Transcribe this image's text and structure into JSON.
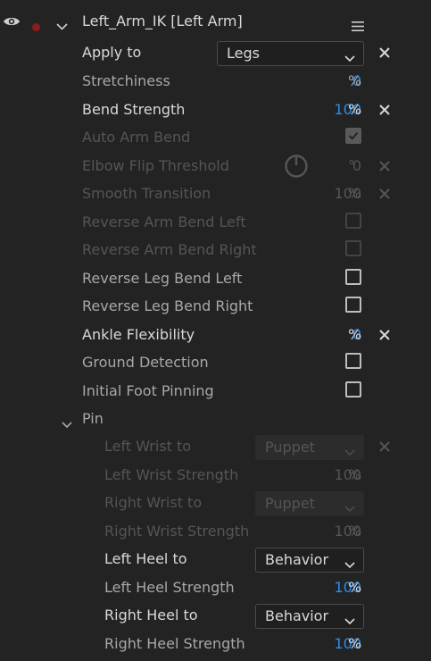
{
  "header": {
    "title": "Left_Arm_IK [Left Arm]"
  },
  "colors": {
    "background": "#232323",
    "value_blue": "#2d8ceb",
    "record_dot": "#8a1d1d"
  },
  "rows": {
    "apply_to": {
      "label": "Apply to",
      "value": "Legs"
    },
    "stretchiness": {
      "label": "Stretchiness",
      "value": "0",
      "unit": "%"
    },
    "bend_strength": {
      "label": "Bend Strength",
      "value": "100",
      "unit": "%"
    },
    "auto_arm_bend": {
      "label": "Auto Arm Bend",
      "checked": true
    },
    "elbow_flip_threshold": {
      "label": "Elbow Flip Threshold",
      "value": "0",
      "unit": "°"
    },
    "smooth_transition": {
      "label": "Smooth Transition",
      "value": "100",
      "unit": "%"
    },
    "reverse_arm_bend_left": {
      "label": "Reverse Arm Bend Left",
      "checked": false
    },
    "reverse_arm_bend_right": {
      "label": "Reverse Arm Bend Right",
      "checked": false
    },
    "reverse_leg_bend_left": {
      "label": "Reverse Leg Bend Left",
      "checked": false
    },
    "reverse_leg_bend_right": {
      "label": "Reverse Leg Bend Right",
      "checked": false
    },
    "ankle_flexibility": {
      "label": "Ankle Flexibility",
      "value": "0",
      "unit": "%"
    },
    "ground_detection": {
      "label": "Ground Detection",
      "checked": false
    },
    "initial_foot_pinning": {
      "label": "Initial Foot Pinning",
      "checked": false
    }
  },
  "pin": {
    "label": "Pin",
    "left_wrist_to": {
      "label": "Left Wrist to",
      "value": "Puppet"
    },
    "left_wrist_strength": {
      "label": "Left Wrist Strength",
      "value": "100",
      "unit": "%"
    },
    "right_wrist_to": {
      "label": "Right Wrist to",
      "value": "Puppet"
    },
    "right_wrist_strength": {
      "label": "Right Wrist Strength",
      "value": "100",
      "unit": "%"
    },
    "left_heel_to": {
      "label": "Left Heel to",
      "value": "Behavior"
    },
    "left_heel_strength": {
      "label": "Left Heel Strength",
      "value": "100",
      "unit": "%"
    },
    "right_heel_to": {
      "label": "Right Heel to",
      "value": "Behavior"
    },
    "right_heel_strength": {
      "label": "Right Heel Strength",
      "value": "100",
      "unit": "%"
    }
  }
}
